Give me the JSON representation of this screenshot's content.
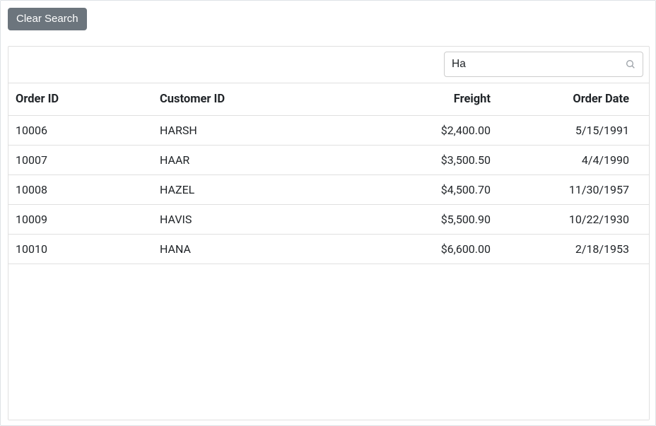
{
  "toolbar": {
    "clear_label": "Clear Search",
    "search_value": "Ha"
  },
  "grid": {
    "headers": {
      "order_id": "Order ID",
      "customer_id": "Customer ID",
      "freight": "Freight",
      "order_date": "Order Date"
    },
    "rows": [
      {
        "order_id": "10006",
        "customer_id": "HARSH",
        "freight": "$2,400.00",
        "order_date": "5/15/1991"
      },
      {
        "order_id": "10007",
        "customer_id": "HAAR",
        "freight": "$3,500.50",
        "order_date": "4/4/1990"
      },
      {
        "order_id": "10008",
        "customer_id": "HAZEL",
        "freight": "$4,500.70",
        "order_date": "11/30/1957"
      },
      {
        "order_id": "10009",
        "customer_id": "HAVIS",
        "freight": "$5,500.90",
        "order_date": "10/22/1930"
      },
      {
        "order_id": "10010",
        "customer_id": "HANA",
        "freight": "$6,600.00",
        "order_date": "2/18/1953"
      }
    ]
  }
}
